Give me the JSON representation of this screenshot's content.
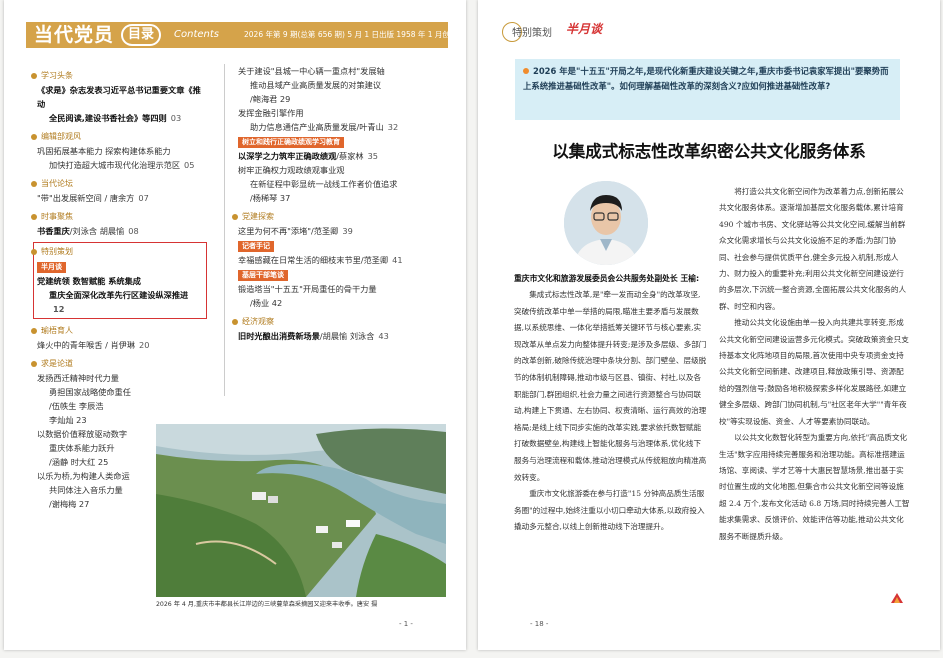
{
  "left": {
    "header": {
      "title": "当代党员",
      "mulu": "目录",
      "contents": "Contents",
      "issue": "2026 年第 9 期(总第 656 期) 5 月 1 日出版  1958 年 1 月创刊"
    },
    "colA": [
      {
        "h": "学习头条"
      },
      {
        "t": "《求是》杂志发表习近平总书记重要文章《推动",
        "b": true
      },
      {
        "t": "全民阅读,建设书香社会》等四则",
        "p": "03",
        "b": true,
        "ind": true
      },
      {
        "h": "编辑部观风"
      },
      {
        "t": "巩固拓展基本能力   探索构建体系能力"
      },
      {
        "t": "加快打造超大城市现代化治理示范区",
        "p": "05",
        "ind": true
      },
      {
        "h": "当代论坛"
      },
      {
        "t": "\"带\"出发展新空间 / 唐余方",
        "p": "07"
      },
      {
        "h": "时事聚焦"
      },
      {
        "t": "书香重庆",
        "b": true,
        "tail": "/刘泳含   胡晨愉",
        "p": "08"
      },
      {
        "feature": true
      },
      {
        "h": "瑜梧育人"
      },
      {
        "t": "烽火中的青年喉舌 / 肖伊琳",
        "p": "20"
      },
      {
        "h": "求是论道"
      },
      {
        "t": "发扬西迁精神时代力量"
      },
      {
        "t": "勇担国家战略使命重任",
        "ind": true
      },
      {
        "t": "/伍帙生   李辰浩",
        "ind": true
      },
      {
        "t": "李灿灿  23",
        "ind": true
      },
      {
        "t": "以数据价值释放驱动数字"
      },
      {
        "t": "重庆体系能力跃升",
        "ind": true
      },
      {
        "t": "/涵静   时大红   25",
        "ind": true
      },
      {
        "t": "以乐为桥,为构建人类命运"
      },
      {
        "t": "共同体注入音乐力量",
        "ind": true
      },
      {
        "t": "/谢梅梅   27",
        "ind": true
      }
    ],
    "feature": {
      "h": "特别策划",
      "tag": "半月谈",
      "line1": "党建统领   数智赋能   系统集成",
      "line2": "重庆全面深化改革先行区建设纵深推进",
      "p": "12"
    },
    "colB": [
      {
        "t": "关于建设\"县城一中心辆一重点村\"发展轴"
      },
      {
        "t": "推动县域产业高质量发展的对策建议",
        "ind": true
      },
      {
        "t": "/鲍海君  29",
        "ind": true
      },
      {
        "t": "发挥金融引擎作用"
      },
      {
        "t": "助力信息通信产业高质量发展/叶青山",
        "p": "32",
        "ind": true
      },
      {
        "tag": "树立和践行正确政绩观学习教育"
      },
      {
        "t": "以深学之力筑牢正确政绩观",
        "b": true,
        "tail": "/蔡家林",
        "p": "35"
      },
      {
        "t": "树牢正确权力观政绩观事业观"
      },
      {
        "t": "在新征程中彰显统一战线工作者价值追求",
        "ind": true
      },
      {
        "t": "/杨稀琴   37",
        "ind": true
      },
      {
        "h": "党建探索"
      },
      {
        "t": "这里为何不再\"添堵\"/范圣卿",
        "p": "39"
      },
      {
        "tag": "记者手记"
      },
      {
        "t": "幸福感藏在日常生活的细枝末节里/范圣卿",
        "p": "41"
      },
      {
        "tag": "基层干部笔谈"
      },
      {
        "t": "锻造塔当\"十五五\"开局重任的骨干力量"
      },
      {
        "t": "/杨业   42",
        "ind": true
      },
      {
        "h": "经济观察"
      },
      {
        "t": "旧时光酿出消费新场景",
        "b": true,
        "tail": "/胡晨愉   刘泳含",
        "p": "43"
      }
    ],
    "caption": "2026 年 4 月,重庆市丰都县长江岸边的三峡蔓草森采摘园又迎来丰收季。唐安 摄",
    "page_number": "- 1 -"
  },
  "right": {
    "header_label": "特别策划",
    "header_tag": "半月谈",
    "intro": "2026 年是\"十五五\"开局之年,是现代化新重庆建设关键之年,重庆市委书记袁家军提出\"要聚势而上系统推进基础性改革\"。如何理解基础性改革的深刻含义?应如何推进基础性改革?",
    "title": "以集成式标志性改革织密公共文化服务体系",
    "author": "重庆市文化和旅游发展委员会公共服务处副处长  王榆:",
    "left_paras": [
      "集成式标志性改革,是\"牵一发而动全身\"的改革攻坚,突破传统改革中单一举措的局限,瞄准主要矛盾与发展数据,以系统思维、一体化举措抵筹关键环节与核心要素,实现改革从单点发力向整体提升转变;是涉及多层级、多部门的改革创新,破除传统治理中条块分割、部门壁垒、层级脱节的体制机制障碍,推动市级与区县、镇街、村社,以及各职能部门,群团组织,社会力量之间进行资源整合与协同联动,构建上下贯通、左右协同、权责清晰、运行高效的治理格局;是线上线下同步实施的改革实践,要求依托数智赋能打破数据壁垒,构建线上智能化服务与治理体系,优化线下服务与治理流程和载体,推动治理模式从传统粗放向精准高效转变。",
      "重庆市文化旅游委在参与打造\"15 分钟高品质生活服务圈\"的过程中,始终注重以小切口牵动大体系,以政府投入撬动多元整合,以线上创新推动线下治理提升。"
    ],
    "right_paras": [
      "将打造公共文化新空间作为改革着力点,创新拓展公共文化服务体系。逐渐增加基层文化服务载体,累计培育 490 个城市书房、文化驿站等公共文化空间,缓解当前群众文化需求增长与公共文化设施不足的矛盾;为部门协同、社会参与提供优质平台,健全多元投入机制,形成人力、财力投入的重要补充;利用公共文化新空间建设逆行的多层次,下沉统一整合资源,全面拓展公共文化服务的人群、时空和内容。",
      "推动公共文化设施由单一投入向共建共享转变,形成公共文化新空间建设运营多元化模式。突破政策资金只支持基本文化阵地项目的局限,首次使用中央专项资金支持公共文化新空间新建、改建项目,释放政策引导、资源配给的强烈信号;鼓励各地积极探索多样化发展路径,如建立健全多层级、跨部门协同机制,与\"社区老年大学\"\"青年夜校\"等实现设施、资金、人才等要素协同联动。",
      "以公共文化数智化转型为重要方向,依托\"高品质文化生活\"数字应用持续完善服务和治理功能。高标准搭建运场馆、享阅读、学才艺等十大惠民智慧场景,推出基于实时位置生成的文化地图,但集合市公共文化新空间等设施超 2.4 万个,发布文化活动 6.8 万场,同时持续完善人工智能求集需求、反馈评价、效能评估等功能,推动公共文化服务不断提质升级。"
    ],
    "page_number": "- 18 -"
  }
}
